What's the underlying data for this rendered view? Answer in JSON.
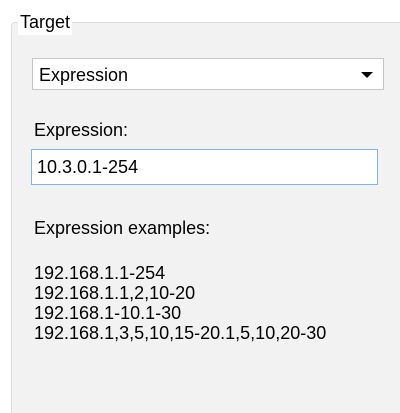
{
  "target_group": {
    "title": "Target",
    "target_type": {
      "selected": "Expression",
      "icon": "chevron-down-icon"
    },
    "expression": {
      "label": "Expression:",
      "value": "10.3.0.1-254"
    },
    "examples": {
      "title": "Expression examples:",
      "items": [
        "192.168.1.1-254",
        "192.168.1.1,2,10-20",
        "192.168.1-10.1-30",
        "192.168.1,3,5,10,15-20.1,5,10,20-30"
      ]
    }
  },
  "colors": {
    "group_background": "#f2f2f2",
    "group_border": "#d5dfe5",
    "input_focus_border": "#7eb4ea",
    "select_border": "#c6c6c6"
  }
}
